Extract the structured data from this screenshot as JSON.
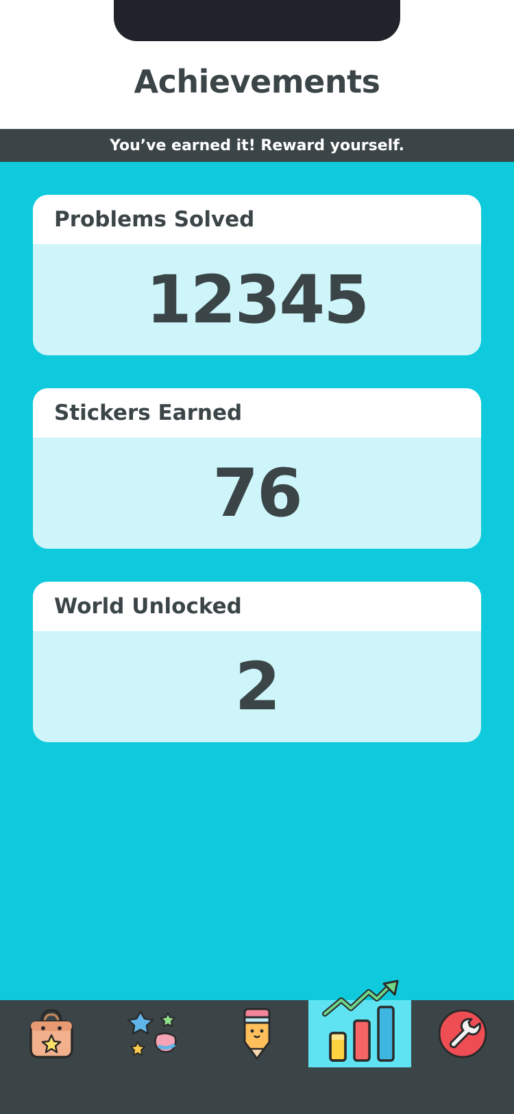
{
  "header": {
    "title": "Achievements"
  },
  "banner": {
    "text": "You’ve earned it! Reward yourself."
  },
  "stats": [
    {
      "label": "Problems Solved",
      "value": "12345"
    },
    {
      "label": "Stickers Earned",
      "value": "76"
    },
    {
      "label": "World Unlocked",
      "value": "2"
    }
  ],
  "tabbar": {
    "items": [
      {
        "icon": "shopping-bag-icon"
      },
      {
        "icon": "stickers-icon"
      },
      {
        "icon": "pencil-icon"
      },
      {
        "icon": "chart-icon",
        "selected": true
      },
      {
        "icon": "wrench-icon"
      }
    ]
  },
  "colors": {
    "background": "#0ecadc",
    "dark": "#3b4548",
    "card_body": "#cdf5fa",
    "tab_active": "#5fe3f2"
  }
}
